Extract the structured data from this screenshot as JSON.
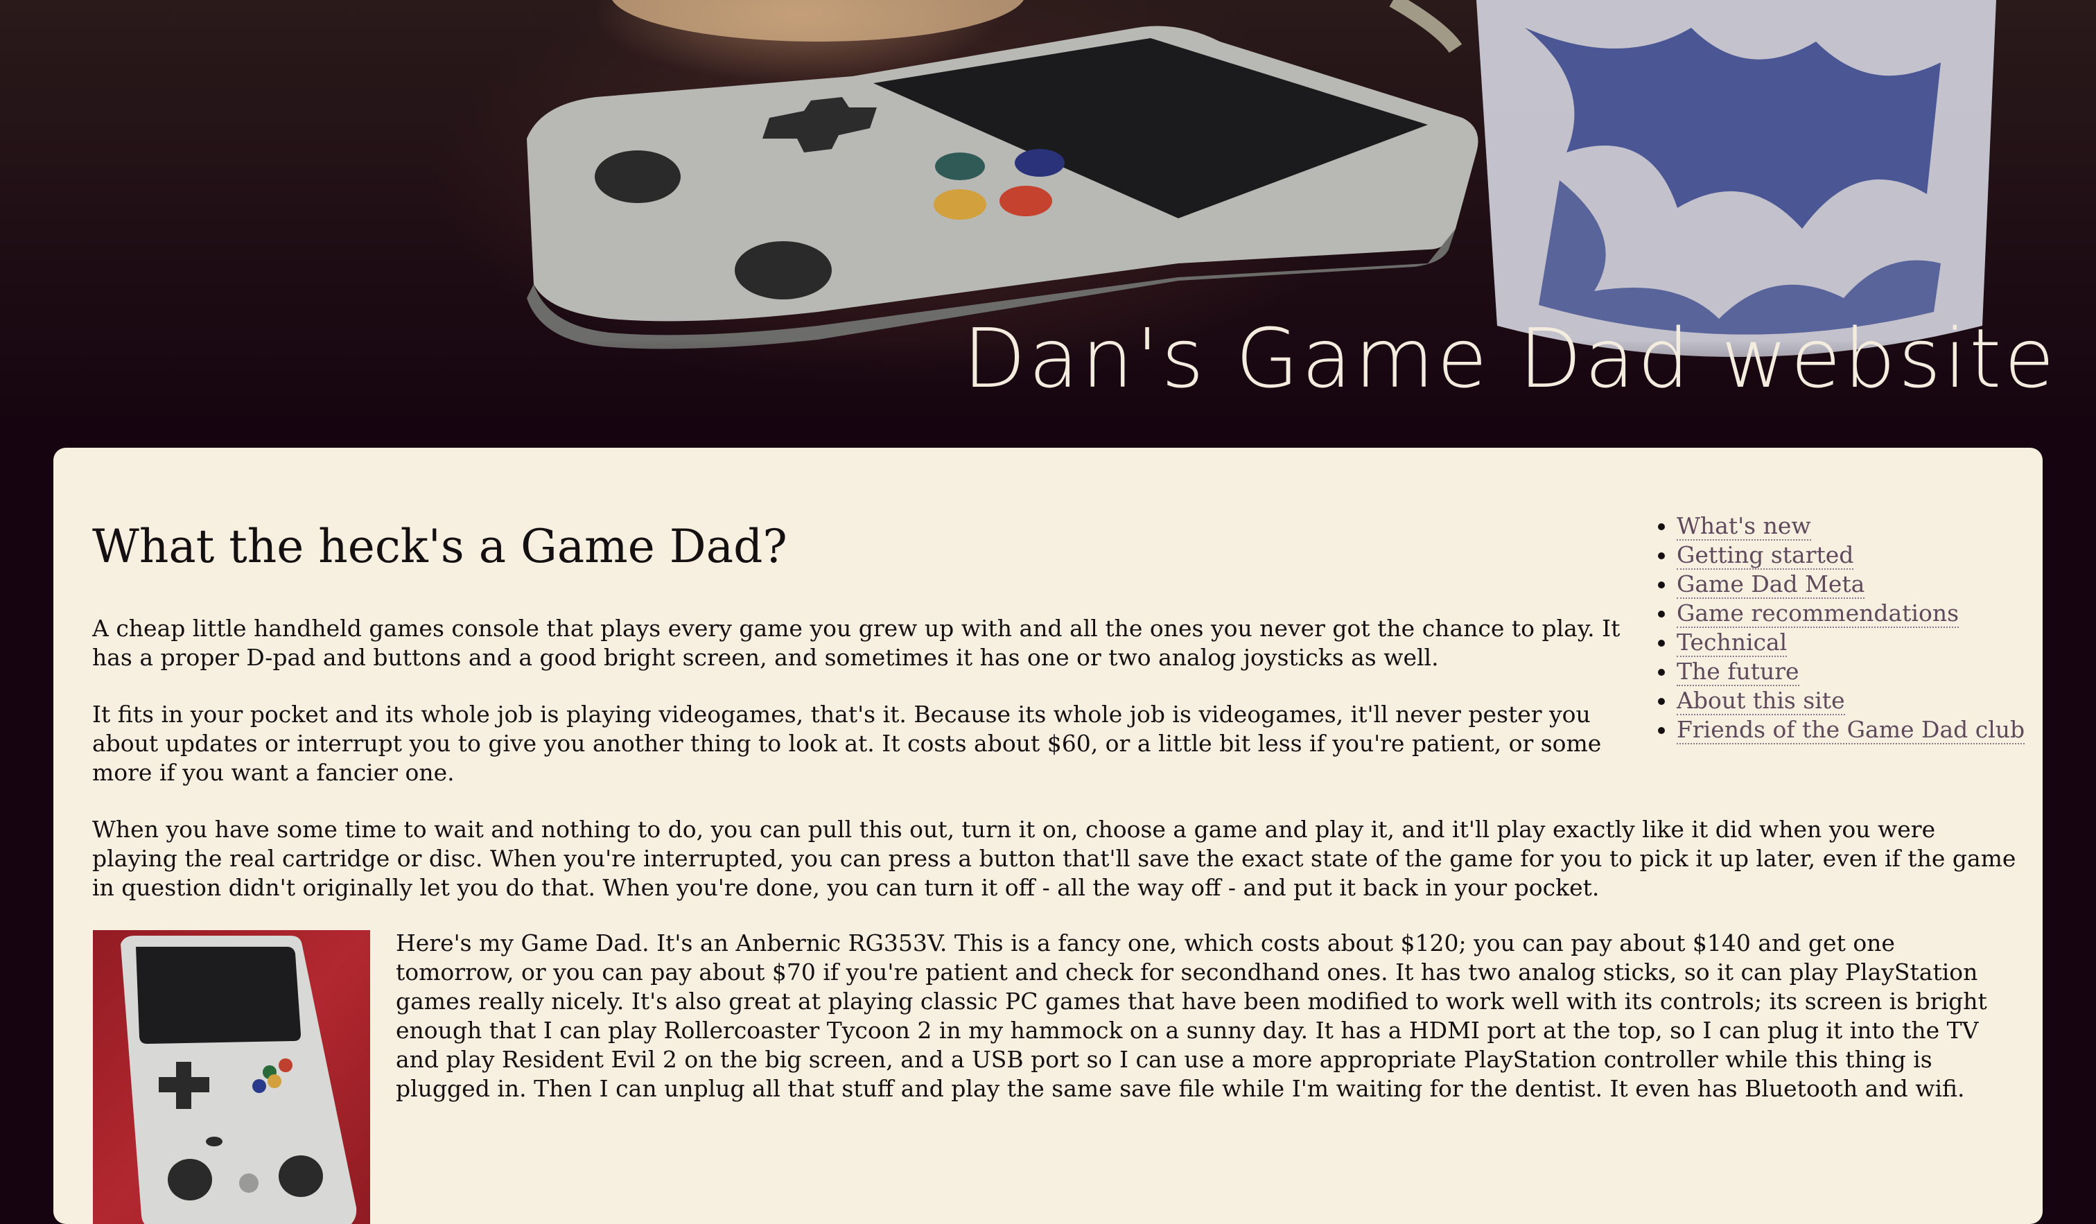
{
  "site": {
    "title": "Dan's Game Dad website"
  },
  "article": {
    "heading": "What the heck's a Game Dad?",
    "paragraphs": [
      "A cheap little handheld games console that plays every game you grew up with and all the ones you never got the chance to play. It has a proper D-pad and buttons and a good bright screen, and sometimes it has one or two analog joysticks as well.",
      "It fits in your pocket and its whole job is playing videogames, that's it. Because its whole job is videogames, it'll never pester you about updates or interrupt you to give you another thing to look at. It costs about $60, or a little bit less if you're patient, or some more if you want a fancier one.",
      "When you have some time to wait and nothing to do, you can pull this out, turn it on, choose a game and play it, and it'll play exactly like it did when you were playing the real cartridge or disc. When you're interrupted, you can press a button that'll save the exact state of the game for you to pick it up later, even if the game in question didn't originally let you do that. When you're done, you can turn it off - all the way off - and put it back in your pocket.",
      "Here's my Game Dad. It's an Anbernic RG353V. This is a fancy one, which costs about $120; you can pay about $140 and get one tomorrow, or you can pay about $70 if you're patient and check for secondhand ones. It has two analog sticks, so it can play PlayStation games really nicely. It's also great at playing classic PC games that have been modified to work well with its controls; its screen is bright enough that I can play Rollercoaster Tycoon 2 in my hammock on a sunny day. It has a HDMI port at the top, so I can plug it into the TV and play Resident Evil 2 on the big screen, and a USB port so I can use a more appropriate PlayStation controller while this thing is plugged in. Then I can unplug all that stuff and play the same save file while I'm waiting for the dentist. It even has Bluetooth and wifi."
    ]
  },
  "toc": {
    "items": [
      {
        "label": "What's new"
      },
      {
        "label": "Getting started"
      },
      {
        "label": "Game Dad Meta"
      },
      {
        "label": "Game recommendations"
      },
      {
        "label": "Technical"
      },
      {
        "label": "The future"
      },
      {
        "label": "About this site"
      },
      {
        "label": "Friends of the Game Dad club"
      }
    ]
  },
  "colors": {
    "page_background": "#160510",
    "card_background": "#f7f0e0",
    "link": "#5f4a5c",
    "title_text": "#f4ecdf"
  }
}
